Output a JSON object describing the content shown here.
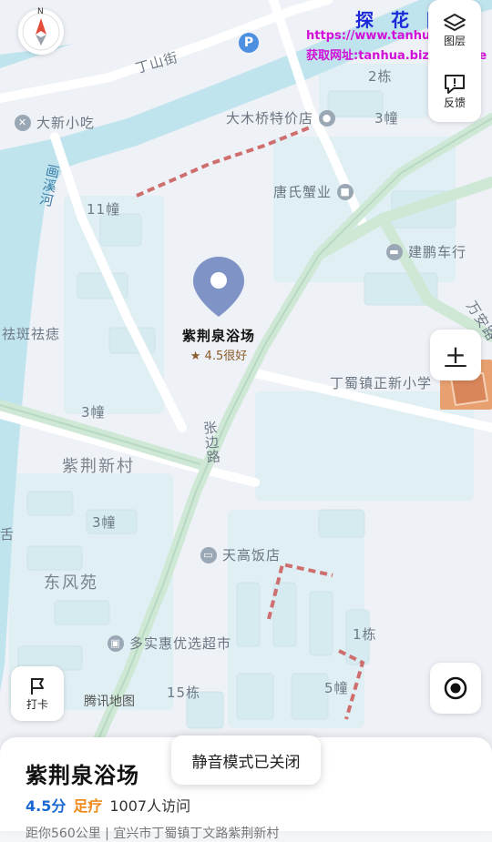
{
  "map": {
    "streets": [
      "丁山街",
      "张边路",
      "万安路"
    ],
    "river": "画溪河",
    "areas": [
      "紫荆新村",
      "东风苑"
    ],
    "buildings": [
      "2栋",
      "3幢",
      "11幢",
      "3幢",
      "3幢",
      "15栋",
      "1栋",
      "5幢"
    ],
    "edge_labels": [
      "祛斑祛痣",
      "舌"
    ],
    "pois": {
      "dxxc": "大新小吃",
      "dmq": "大木桥特价店",
      "tsxy": "唐氏蟹业",
      "jpch": "建鹏车行",
      "dszx": "丁蜀镇正新小学",
      "tgfd": "天高饭店",
      "dshcs": "多实惠优选超市"
    },
    "brand": "腾讯地图"
  },
  "marker": {
    "name": "紫荆泉浴场",
    "rating": "4.5很好",
    "pin_color": "#7f93c6"
  },
  "controls": {
    "layers_label": "图层",
    "feedback_label": "反馈",
    "zoom_label": "+",
    "checkin_label": "打卡",
    "compass": "N"
  },
  "watermark": {
    "title": "探 花 网",
    "url": "https://www.tanhua.biz",
    "contact": "获取网址:tanhua.biz@pm.me"
  },
  "bottom_card": {
    "title": "紫荆泉浴场",
    "score": "4.5分",
    "category": "足疗",
    "visits": "1007人访问",
    "info": "距你560公里 | 宜兴市丁蜀镇丁文路紫荆新村"
  },
  "toast": {
    "message": "静音模式已关闭"
  },
  "colors": {
    "river": "#bfe4ee",
    "accent": "#f08a1c",
    "score": "#1967d2",
    "dashed_boundary": "#cf6e6e"
  }
}
